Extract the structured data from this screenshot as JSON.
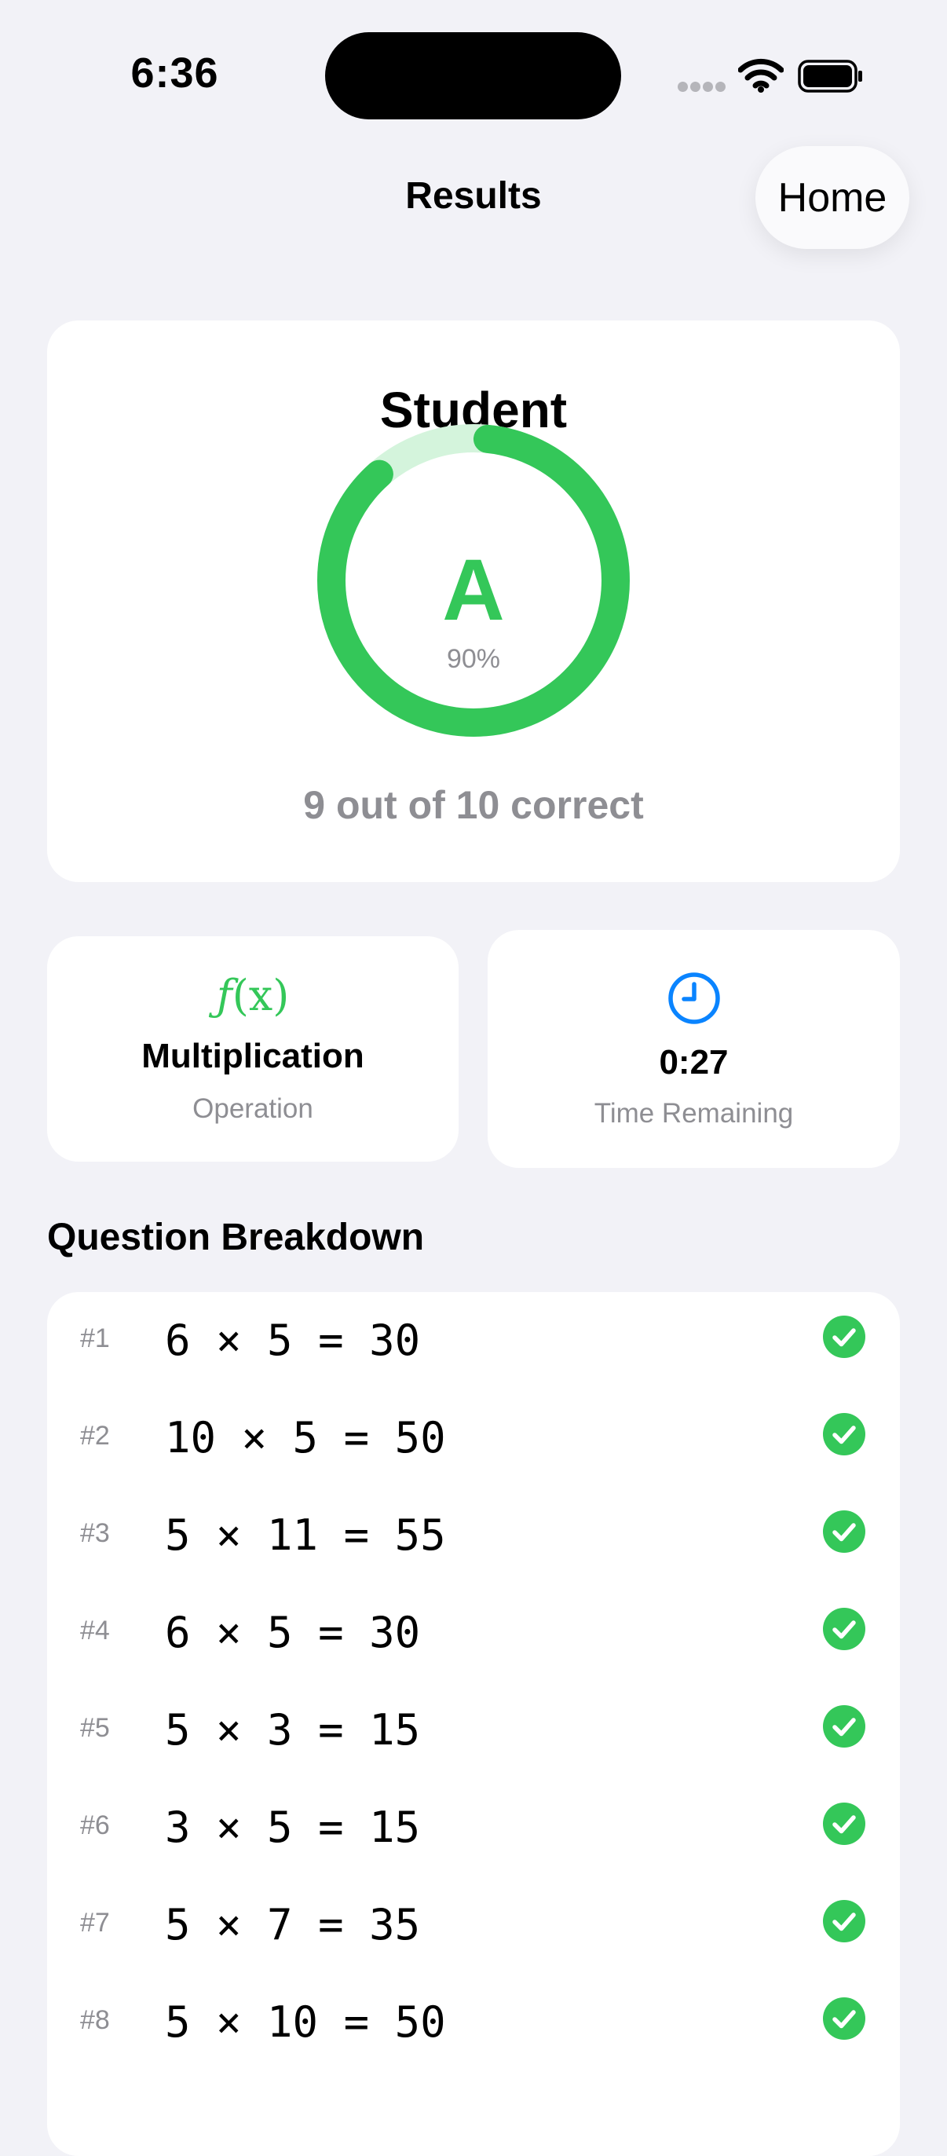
{
  "status_bar": {
    "time": "6:36"
  },
  "nav": {
    "title": "Results",
    "home_label": "Home"
  },
  "grade_card": {
    "student_name": "Student",
    "grade_letter": "A",
    "percent_text": "90%",
    "score_fraction": 0.9,
    "correct_text": "9 out of 10 correct"
  },
  "operation_card": {
    "icon_text_f": "ƒ",
    "icon_text_x": "(x)",
    "value": "Multiplication",
    "label": "Operation"
  },
  "time_card": {
    "value": "0:27",
    "label": "Time Remaining"
  },
  "breakdown": {
    "title": "Question Breakdown",
    "questions": [
      {
        "number": "#1",
        "expression": "6 × 5 = 30",
        "correct": true
      },
      {
        "number": "#2",
        "expression": "10 × 5 = 50",
        "correct": true
      },
      {
        "number": "#3",
        "expression": "5 × 11 = 55",
        "correct": true
      },
      {
        "number": "#4",
        "expression": "6 × 5 = 30",
        "correct": true
      },
      {
        "number": "#5",
        "expression": "5 × 3 = 15",
        "correct": true
      },
      {
        "number": "#6",
        "expression": "3 × 5 = 15",
        "correct": true
      },
      {
        "number": "#7",
        "expression": "5 × 7 = 35",
        "correct": true
      },
      {
        "number": "#8",
        "expression": "5 × 10 = 50",
        "correct": true
      }
    ]
  },
  "colors": {
    "accent_green": "#34C759",
    "accent_green_light": "#D4F4DC",
    "accent_blue": "#0A84FF",
    "secondary_text": "#8E8E93",
    "background": "#F2F2F7"
  },
  "icons": {
    "status": [
      "cellular-signal-icon",
      "wifi-icon",
      "battery-icon"
    ],
    "operation": "function-icon",
    "time": "clock-icon",
    "question_status": "checkmark-circle-icon"
  }
}
